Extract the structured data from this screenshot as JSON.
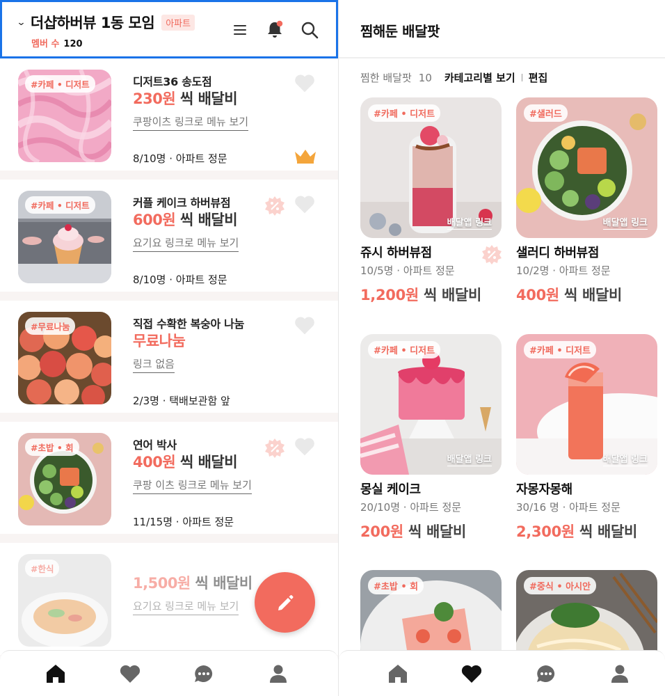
{
  "left": {
    "header": {
      "title": "더샵하버뷰 1동 모임",
      "badge": "아파트",
      "members_label": "멤버 수",
      "members_count": "120",
      "icons": [
        "chevron-down-icon",
        "menu-icon",
        "bell-icon",
        "search-icon"
      ]
    },
    "posts": [
      {
        "tag": "#카페 • 디저트",
        "name": "디저트36 송도점",
        "fee_amount": "230원",
        "fee_suffix": " 씩 배달비",
        "link": "쿠팡이츠 링크로 메뉴 보기",
        "count": "8/10명 · 아파트 정문",
        "coupon": false,
        "crown": true
      },
      {
        "tag": "#카페 • 디저트",
        "name": "커플 케이크 하버뷰점",
        "fee_amount": "600원",
        "fee_suffix": " 씩 배달비",
        "link": "요기요 링크로 메뉴 보기",
        "count": "8/10명 · 아파트 정문",
        "coupon": true,
        "crown": false
      },
      {
        "tag": "#무료나눔",
        "name": "직접 수확한 복숭아 나눔",
        "fee_amount": "무료나눔",
        "fee_suffix": "",
        "link": "링크 없음",
        "count": "2/3명 · 택배보관함 앞",
        "coupon": false,
        "crown": false
      },
      {
        "tag": "#초밥 • 회",
        "name": "연어 박사",
        "fee_amount": "400원",
        "fee_suffix": " 씩 배달비",
        "link": "쿠팡 이츠 링크로 메뉴 보기",
        "count": "11/15명 · 아파트 정문",
        "coupon": true,
        "crown": false
      },
      {
        "tag": "#한식",
        "name": "",
        "fee_amount": "1,500원",
        "fee_suffix": " 씩 배달비",
        "link": "요기요 링크로 메뉴 보기",
        "count": "",
        "coupon": false,
        "crown": false
      }
    ],
    "fab_icon": "pencil-icon",
    "tabbar": {
      "active": "home",
      "tabs": [
        "home-icon",
        "heart-icon",
        "chat-icon",
        "profile-icon"
      ]
    }
  },
  "right": {
    "header": {
      "title": "찜해둔 배달팟"
    },
    "subbar": {
      "label": "찜한 배달팟",
      "count": "10",
      "category": "카테고리별 보기",
      "edit": "편집"
    },
    "items": [
      {
        "tag": "#카페 • 디저트",
        "name": "쥬시 하버뷰점",
        "count": "10/5명 · 아파트 정문",
        "fee_amount": "1,200원",
        "fee_suffix": " 씩  배달비",
        "app_link": "배달앱 링크",
        "coupon": true
      },
      {
        "tag": "#샐러드",
        "name": "샐러디 하버뷰점",
        "count": "10/2명 · 아파트 정문",
        "fee_amount": "400원",
        "fee_suffix": " 씩  배달비",
        "app_link": "배달앱 링크",
        "coupon": false
      },
      {
        "tag": "#카페 • 디저트",
        "name": "몽실 케이크",
        "count": "20/10명 · 아파트 정문",
        "fee_amount": "200원",
        "fee_suffix": " 씩  배달비",
        "app_link": "배달앱 링크",
        "coupon": false
      },
      {
        "tag": "#카페 • 디저트",
        "name": "자몽자몽해",
        "count": "30/16 명 · 아파트 정문",
        "fee_amount": "2,300원",
        "fee_suffix": " 씩  배달비",
        "app_link": "배달앱 링크",
        "coupon": false
      },
      {
        "tag": "#초밥 • 회",
        "name": "",
        "count": "",
        "fee_amount": "",
        "fee_suffix": "",
        "app_link": "",
        "coupon": false
      },
      {
        "tag": "#중식 • 아시안",
        "name": "",
        "count": "",
        "fee_amount": "",
        "fee_suffix": "",
        "app_link": "",
        "coupon": false
      }
    ],
    "tabbar": {
      "active": "heart",
      "tabs": [
        "home-icon",
        "heart-icon",
        "chat-icon",
        "profile-icon"
      ]
    }
  },
  "colors": {
    "accent": "#f26b5e",
    "tag_text": "#f06a5d",
    "badge_bg": "#fde7e4",
    "focus_border": "#1a73e8",
    "crown": "#f4a53b"
  }
}
